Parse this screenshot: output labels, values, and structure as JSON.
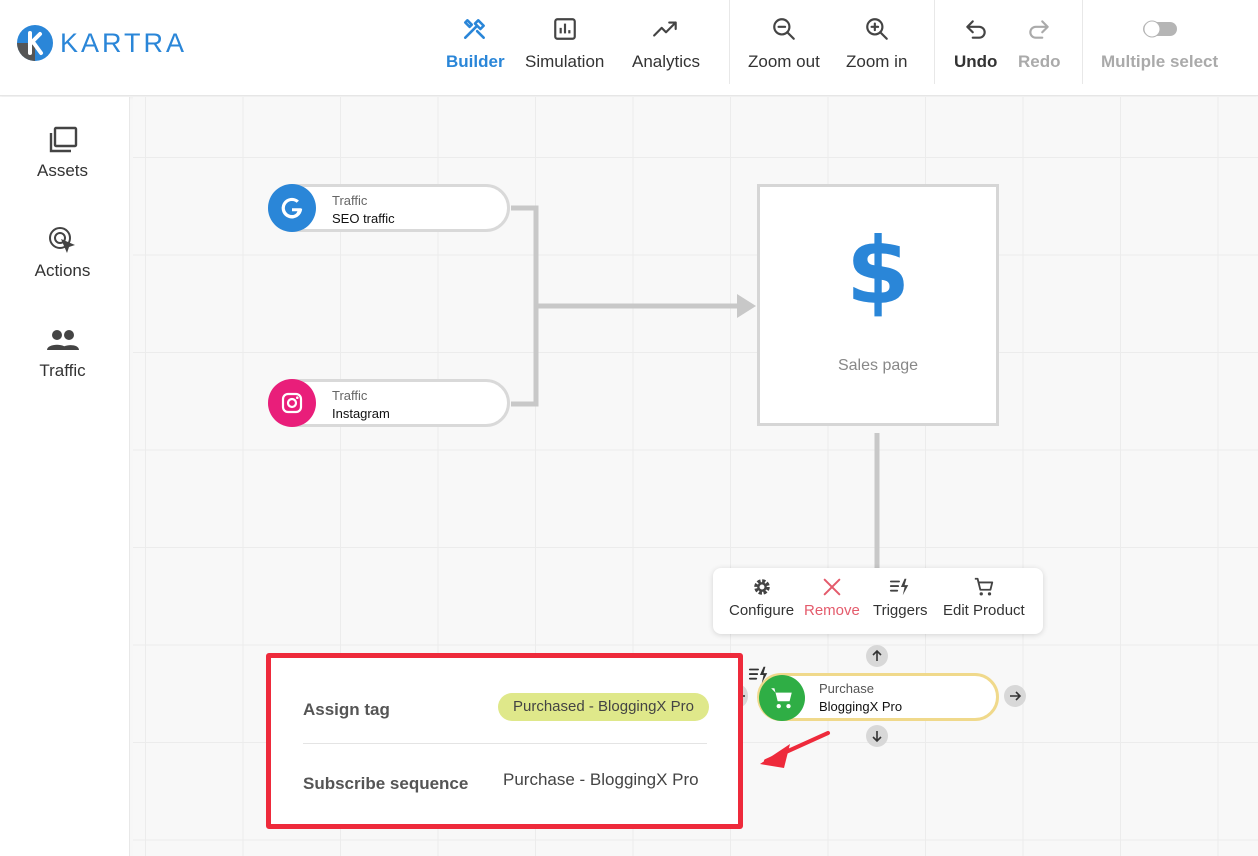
{
  "app": {
    "logo_text": "KARTRA"
  },
  "toolbar": {
    "builder": "Builder",
    "simulation": "Simulation",
    "analytics": "Analytics",
    "zoom_out": "Zoom out",
    "zoom_in": "Zoom in",
    "undo": "Undo",
    "redo": "Redo",
    "multiple_select": "Multiple select"
  },
  "sidebar": {
    "items": [
      {
        "label": "Assets",
        "icon": "assets-icon"
      },
      {
        "label": "Actions",
        "icon": "actions-icon"
      },
      {
        "label": "Traffic",
        "icon": "traffic-icon"
      }
    ]
  },
  "canvas": {
    "traffic_nodes": [
      {
        "type": "Traffic",
        "name": "SEO traffic",
        "icon": "google-icon"
      },
      {
        "type": "Traffic",
        "name": "Instagram",
        "icon": "instagram-icon"
      }
    ],
    "sales_page": {
      "symbol": "$",
      "caption": "Sales page"
    },
    "node_menu": {
      "configure": "Configure",
      "remove": "Remove",
      "triggers": "Triggers",
      "edit_product": "Edit Product"
    },
    "purchase_node": {
      "type": "Purchase",
      "name": "BloggingX Pro",
      "icon": "cart-icon"
    },
    "details": {
      "assign_tag_label": "Assign tag",
      "assign_tag_value": "Purchased - BloggingX Pro",
      "subscribe_label": "Subscribe sequence",
      "subscribe_value": "Purchase - BloggingX Pro"
    }
  },
  "colors": {
    "accent": "#2a86d8",
    "annotation_red": "#ee2a3b",
    "tag_bg": "#dfe88a",
    "purchase_green": "#2fae45",
    "instagram_pink": "#e91e7a"
  }
}
